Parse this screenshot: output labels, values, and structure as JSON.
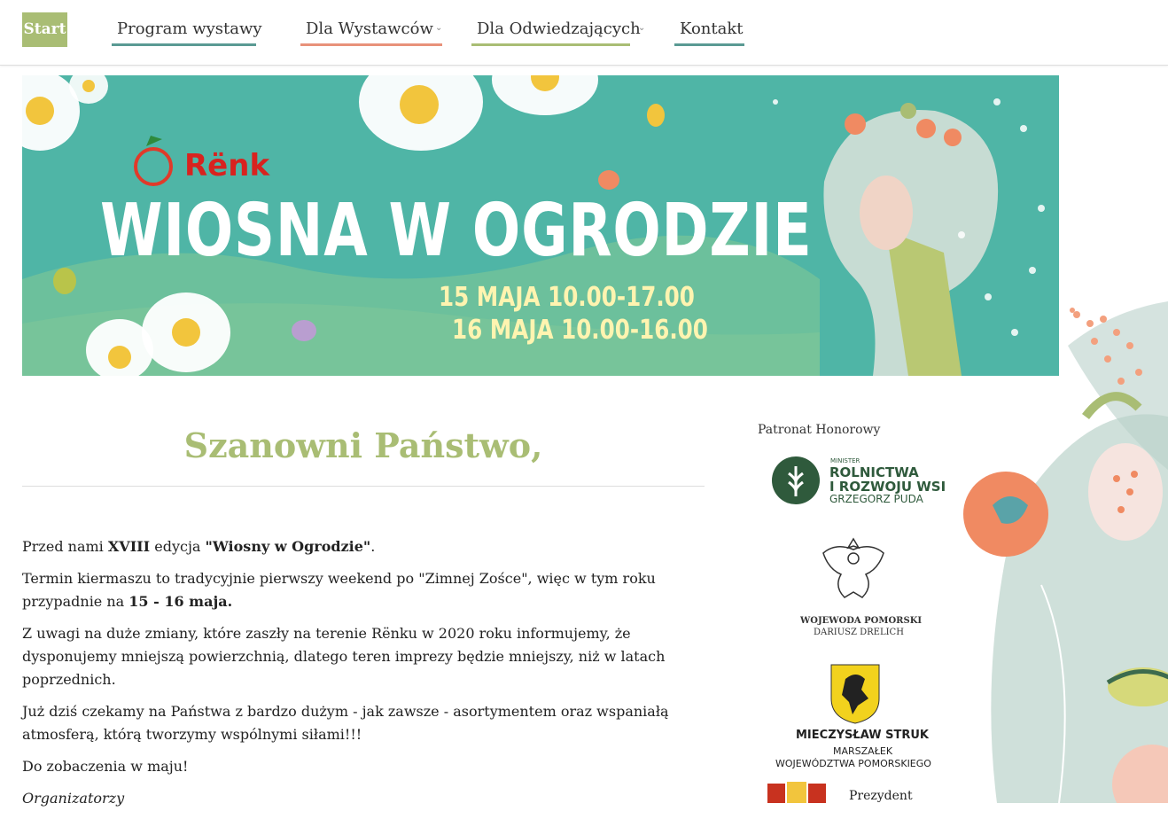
{
  "nav": {
    "start": "Start",
    "items": [
      {
        "label": "Program wystawy",
        "color": "#5a9a93"
      },
      {
        "label": "Dla Wystawców",
        "color": "#e8917a"
      },
      {
        "label": "Dla Odwiedzających",
        "color": "#a9bd74"
      },
      {
        "label": "Kontakt",
        "color": "#5a9a93"
      }
    ]
  },
  "banner": {
    "brand": "Rënk",
    "title": "WIOSNA W OGRODZIE",
    "date1": "15 MAJA 10.00-17.00",
    "date2": "16 MAJA 10.00-16.00"
  },
  "main": {
    "heading": "Szanowni Państwo,",
    "p1_a": "Przed nami ",
    "p1_b": "XVIII",
    "p1_c": " edycja ",
    "p1_d": "\"Wiosny w Ogrodzie\"",
    "p1_e": ".",
    "p2_a": "Termin kiermaszu to tradycyjnie pierwszy weekend po \"Zimnej Zośce\", więc w tym roku przypadnie na ",
    "p2_b": "15 - 16 maja.",
    "p3": "Z uwagi na duże zmiany, które zaszły na terenie Rënku w 2020 roku informujemy, że dysponujemy mniejszą powierzchnią, dlatego teren imprezy będzie mniejszy, niż w latach poprzednich.",
    "p4": "Już dziś czekamy na Państwa z bardzo dużym - jak zawsze - asortymentem oraz wspaniałą atmosferą, którą tworzymy wspólnymi siłami!!!",
    "p5": "Do zobaczenia w maju!",
    "signature": "Organizatorzy"
  },
  "sidebar": {
    "title": "Patronat Honorowy",
    "minister": {
      "small": "MINISTER",
      "l1": "ROLNICTWA",
      "l2": "I ROZWOJU WSI",
      "l3": "GRZEGORZ PUDA"
    },
    "wojewoda": {
      "l1": "WOJEWODA POMORSKI",
      "l2": "DARIUSZ DRELICH"
    },
    "marszalek": {
      "l1": "MIECZYSŁAW STRUK",
      "l2": "MARSZAŁEK",
      "l3": "WOJEWÓDZTWA POMORSKIEGO"
    },
    "prezydent": "Prezydent"
  },
  "colors": {
    "accent": "#a9bd74",
    "teal": "#52b8a9"
  }
}
